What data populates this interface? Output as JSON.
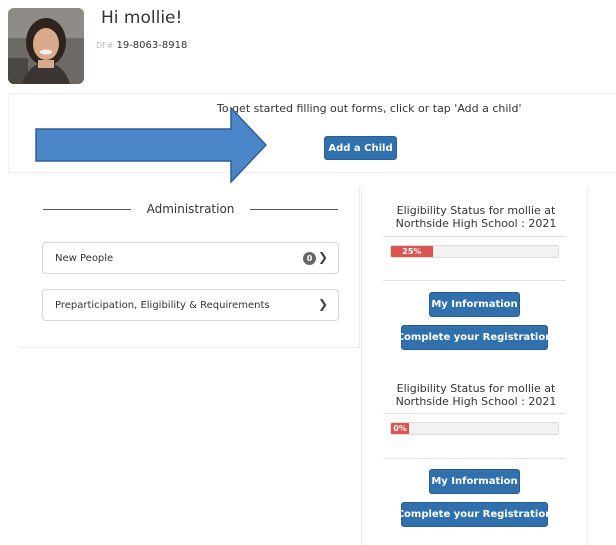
{
  "header": {
    "greeting": "Hi mollie!",
    "df_prefix": "DF#",
    "df_number": "19-8063-8918"
  },
  "start": {
    "instructions": "To get started filling out forms, click or tap 'Add a child'",
    "add_child_label": "Add a Child"
  },
  "admin": {
    "title": "Administration",
    "items": [
      {
        "label": "New People",
        "badge": "0"
      },
      {
        "label": "Preparticipation, Eligibility & Requirements"
      }
    ]
  },
  "eligibility": [
    {
      "title": "Eligibility Status for mollie at Northside High School : 2021",
      "progress": 0.25,
      "progress_label": "25%",
      "my_info_label": "My Information",
      "registration_label": "Complete your Registration"
    },
    {
      "title": "Eligibility Status for mollie at Northside High School : 2021",
      "progress": 0,
      "progress_label": "0%",
      "my_info_label": "My Information",
      "registration_label": "Complete your Registration"
    }
  ],
  "colors": {
    "primary_button": "#2f70ad",
    "progress_fill": "#d9534f",
    "arrow_fill": "#4a86c8"
  },
  "icons": {
    "chevron": "chevron-right-icon",
    "arrow": "right-arrow-annotation"
  }
}
